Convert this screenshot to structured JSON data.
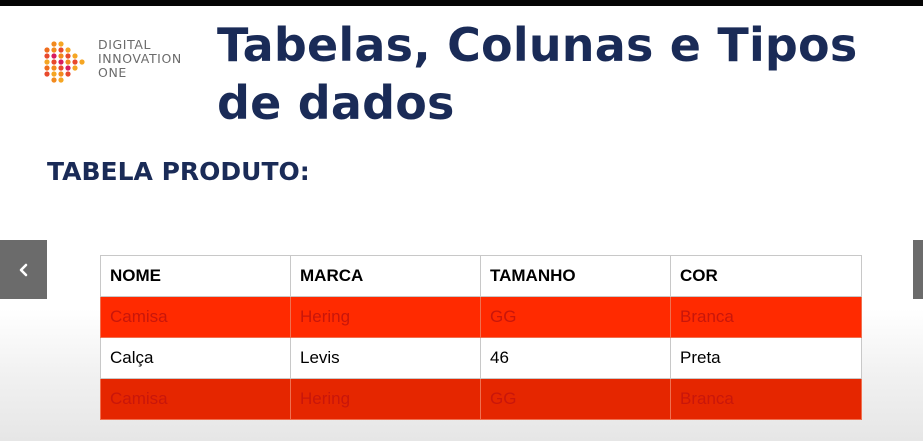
{
  "logo": {
    "lines": [
      "DIGITAL",
      "INNOVATION",
      "ONE"
    ]
  },
  "slide": {
    "title_line1": "Tabelas, Colunas e Tipos",
    "title_line2": "de dados",
    "subtitle": "TABELA PRODUTO:"
  },
  "table": {
    "headers": [
      "NOME",
      "MARCA",
      "TAMANHO",
      "COR"
    ],
    "rows": [
      [
        "Camisa",
        "Hering",
        "GG",
        "Branca"
      ],
      [
        "Calça",
        "Levis",
        "46",
        "Preta"
      ],
      [
        "Camisa",
        "Hering",
        "GG",
        "Branca"
      ]
    ]
  },
  "colors": {
    "accent_red": "#ff2a00",
    "title_navy": "#1a2b57",
    "nav_gray": "#6b6b6b"
  },
  "icons": {
    "prev": "chevron-left-icon",
    "next": "chevron-right-icon"
  }
}
